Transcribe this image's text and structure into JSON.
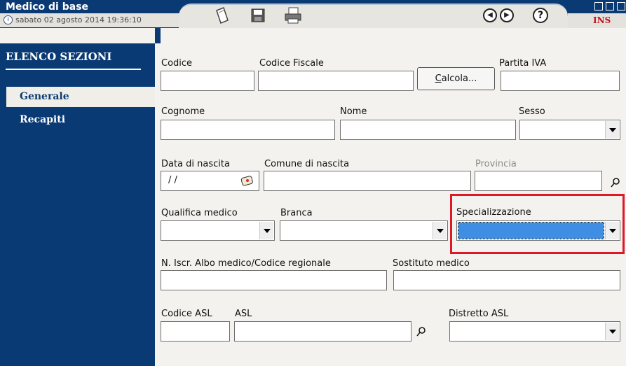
{
  "window": {
    "title": "Medico di base",
    "datetime": "sabato 02 agosto 2014   19:36:10",
    "mode": "INS"
  },
  "toolbar": {
    "icons": [
      "new-document-icon",
      "save-icon",
      "print-icon",
      "previous-record-icon",
      "next-record-icon",
      "help-icon"
    ],
    "help_glyph": "?"
  },
  "sidebar": {
    "heading": "ELENCO SEZIONI",
    "items": [
      {
        "label": "Generale",
        "selected": true
      },
      {
        "label": "Recapiti",
        "selected": false
      }
    ]
  },
  "form": {
    "codice": {
      "label": "Codice",
      "value": ""
    },
    "codice_fiscale": {
      "label": "Codice Fiscale",
      "value": ""
    },
    "calcola_button": "Calcola...",
    "partita_iva": {
      "label": "Partita IVA",
      "value": ""
    },
    "cognome": {
      "label": "Cognome",
      "value": ""
    },
    "nome": {
      "label": "Nome",
      "value": ""
    },
    "sesso": {
      "label": "Sesso",
      "value": ""
    },
    "data_nascita": {
      "label": "Data di nascita",
      "value": " / /"
    },
    "comune_nascita": {
      "label": "Comune di nascita",
      "value": ""
    },
    "provincia": {
      "label": "Provincia",
      "value": ""
    },
    "qualifica_medico": {
      "label": "Qualifica medico",
      "value": ""
    },
    "branca": {
      "label": "Branca",
      "value": ""
    },
    "specializzazione": {
      "label": "Specializzazione",
      "value": ""
    },
    "n_iscr_albo": {
      "label": "N. Iscr. Albo medico/Codice regionale",
      "value": ""
    },
    "sostituto_medico": {
      "label": "Sostituto medico",
      "value": ""
    },
    "codice_asl": {
      "label": "Codice ASL",
      "value": ""
    },
    "asl": {
      "label": "ASL",
      "value": ""
    },
    "distretto_asl": {
      "label": "Distretto ASL",
      "value": ""
    }
  },
  "colors": {
    "sidebar": "#0a3a74",
    "highlight_box": "#e01826",
    "selected_field": "#3e8ee4",
    "mode_text": "#c0121c"
  }
}
